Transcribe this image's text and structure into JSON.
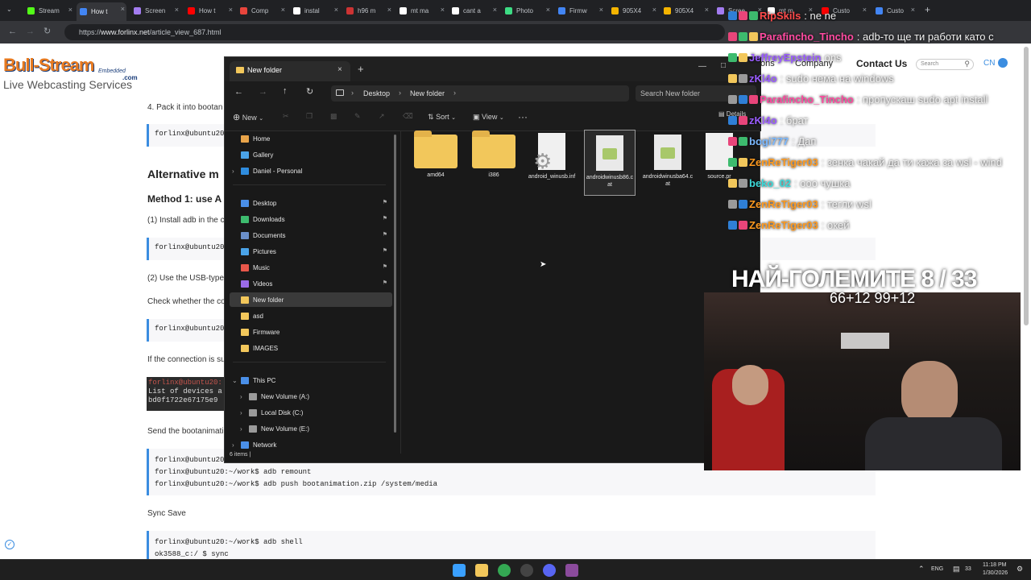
{
  "browser": {
    "tabs": [
      {
        "label": "Stream",
        "color": "#53fc18"
      },
      {
        "label": "How t",
        "color": "#4285f4"
      },
      {
        "label": "Screen",
        "color": "#a37cf0"
      },
      {
        "label": "How t",
        "color": "#ff0000"
      },
      {
        "label": "Comp",
        "color": "#e8453c"
      },
      {
        "label": "instal",
        "color": "#ffffff"
      },
      {
        "label": "h96 m",
        "color": "#cc3333"
      },
      {
        "label": "mt ma",
        "color": "#ffffff"
      },
      {
        "label": "cant a",
        "color": "#ffffff"
      },
      {
        "label": "Photo",
        "color": "#3ddc84"
      },
      {
        "label": "Firmw",
        "color": "#4285f4"
      },
      {
        "label": "905X4",
        "color": "#f4b400"
      },
      {
        "label": "905X4",
        "color": "#f4b400"
      },
      {
        "label": "Scree",
        "color": "#a37cf0"
      },
      {
        "label": "mt m",
        "color": "#ffffff"
      },
      {
        "label": "Custo",
        "color": "#ff0000"
      },
      {
        "label": "Custo",
        "color": "#4285f4"
      }
    ],
    "url_prefix": "https://",
    "url_domain": "www.forlinx.net",
    "url_path": "/article_view_687.html"
  },
  "site": {
    "logo_text": "Bull-Stream",
    "logo_embedded": "Embedded",
    "logo_com": ".com",
    "logo_tagline": "Live Webcasting Services",
    "nav_partial": "ons",
    "nav_company": "Company",
    "nav_contact": "Contact Us",
    "search_placeholder": "Search",
    "lang": "CN",
    "step4": "4. Pack it into bootan",
    "code1": "forlinx@ubuntu20",
    "h_alternative": "Alternative m",
    "h_method1": "Method 1: use A",
    "p_install": "(1) Install adb in the c",
    "code2": "forlinx@ubuntu20",
    "p_usb": "(2) Use the USB-type",
    "p_check": "Check whether the co",
    "code3": "forlinx@ubuntu20",
    "p_connection": "If the connection is su",
    "term_line1": "forlinx@ubuntu20:",
    "term_line2": "List of devices a",
    "term_line3": "bd0f1722e67175e9",
    "p_send": "Send the bootanimati",
    "code4_l1": "forlinx@ubuntu20",
    "code4_l2": "forlinx@ubuntu20:~/work$  adb remount",
    "code4_l3": "forlinx@ubuntu20:~/work$  adb push bootanimation.zip /system/media",
    "p_sync": "Sync Save",
    "code5_l1": "forlinx@ubuntu20:~/work$ adb shell",
    "code5_l2": "ok3588_c:/ $ sync"
  },
  "explorer": {
    "tab_title": "New folder",
    "breadcrumb": [
      "Desktop",
      "New folder"
    ],
    "search_placeholder": "Search New folder",
    "cmd_new": "New",
    "cmd_sort": "Sort",
    "cmd_view": "View",
    "cmd_more": "···",
    "details": "Details",
    "nav": [
      {
        "label": "Home",
        "icon": "home-icon",
        "color": "#e8a44a",
        "pinned": false,
        "chevron": false
      },
      {
        "label": "Gallery",
        "icon": "gallery-icon",
        "color": "#4aa3e8",
        "pinned": false,
        "chevron": false
      },
      {
        "label": "Daniel - Personal",
        "icon": "cloud-icon",
        "color": "#2f8cde",
        "pinned": false,
        "chevron": true
      },
      {
        "label": "Desktop",
        "icon": "desktop-icon",
        "color": "#4a8fe8",
        "pinned": true,
        "chevron": false
      },
      {
        "label": "Downloads",
        "icon": "downloads-icon",
        "color": "#3dbb6e",
        "pinned": true,
        "chevron": false
      },
      {
        "label": "Documents",
        "icon": "documents-icon",
        "color": "#6b8fc9",
        "pinned": true,
        "chevron": false
      },
      {
        "label": "Pictures",
        "icon": "pictures-icon",
        "color": "#4aa3e8",
        "pinned": true,
        "chevron": false
      },
      {
        "label": "Music",
        "icon": "music-icon",
        "color": "#e8574a",
        "pinned": true,
        "chevron": false
      },
      {
        "label": "Videos",
        "icon": "videos-icon",
        "color": "#9a6be8",
        "pinned": true,
        "chevron": false
      },
      {
        "label": "New folder",
        "icon": "folder-icon",
        "color": "#f2c75b",
        "pinned": false,
        "chevron": false
      },
      {
        "label": "asd",
        "icon": "folder-icon",
        "color": "#f2c75b",
        "pinned": false,
        "chevron": false
      },
      {
        "label": "Firmware",
        "icon": "folder-icon",
        "color": "#f2c75b",
        "pinned": false,
        "chevron": false
      },
      {
        "label": "IMAGES",
        "icon": "folder-icon",
        "color": "#f2c75b",
        "pinned": false,
        "chevron": false
      },
      {
        "label": "This PC",
        "icon": "this-pc-icon",
        "color": "#4a8fe8",
        "pinned": false,
        "chevron": true
      },
      {
        "label": "New Volume (A:)",
        "icon": "drive-icon",
        "color": "#9a9a9a",
        "pinned": false,
        "chevron": true
      },
      {
        "label": "Local Disk (C:)",
        "icon": "drive-icon",
        "color": "#9a9a9a",
        "pinned": false,
        "chevron": true
      },
      {
        "label": "New Volume (E:)",
        "icon": "drive-icon",
        "color": "#9a9a9a",
        "pinned": false,
        "chevron": true
      },
      {
        "label": "Network",
        "icon": "network-icon",
        "color": "#4a8fe8",
        "pinned": false,
        "chevron": true
      }
    ],
    "files": [
      {
        "name": "amd64",
        "type": "folder"
      },
      {
        "name": "i386",
        "type": "folder"
      },
      {
        "name": "android_winusb.inf",
        "type": "inf"
      },
      {
        "name": "androidwinusb86.cat",
        "type": "cat"
      },
      {
        "name": "androidwinusba64.cat",
        "type": "cat"
      },
      {
        "name": "source.pr",
        "type": "doc"
      }
    ],
    "status": "6 items  |"
  },
  "chat": [
    {
      "user": "RipSkils",
      "text": ": ne ne",
      "color": "#ff4a4a"
    },
    {
      "user": "Parafincho_Tincho",
      "text": ": adb-то ще ти работи като с",
      "color": "#ff4aa0"
    },
    {
      "user": "JeffreyEpstein",
      "text": "ons",
      "color": "#9a5cff"
    },
    {
      "user": "zKl4o",
      "text": ": sudo нема на windows",
      "color": "#9a5cff"
    },
    {
      "user": "Parafincho_Tincho",
      "text": ": пропускаш sudo apt install",
      "color": "#ff4aa0"
    },
    {
      "user": "zKl4o",
      "text": ": брат",
      "color": "#9a5cff"
    },
    {
      "user": "bogi777",
      "text": ": Дап",
      "color": "#7ab8ff"
    },
    {
      "user": "ZenReTiger03",
      "text": ": зенка чакай да ти кажа за wsl - wind",
      "color": "#ff9a1f"
    },
    {
      "user": "beko_02",
      "text": ": ооо чушка",
      "color": "#3dd9d9"
    },
    {
      "user": "ZenReTiger03",
      "text": ": тегли wsl",
      "color": "#ff9a1f"
    },
    {
      "user": "ZenReTiger03",
      "text": ": окей",
      "color": "#ff9a1f"
    }
  ],
  "overlay": {
    "title": "НАЙ-ГОЛЕМИТЕ 8 / 33",
    "score": "66+12 99+12"
  },
  "taskbar": {
    "lang": "ENG",
    "temp": "33",
    "time": "11:18 PM",
    "date": "1/30/2026"
  }
}
